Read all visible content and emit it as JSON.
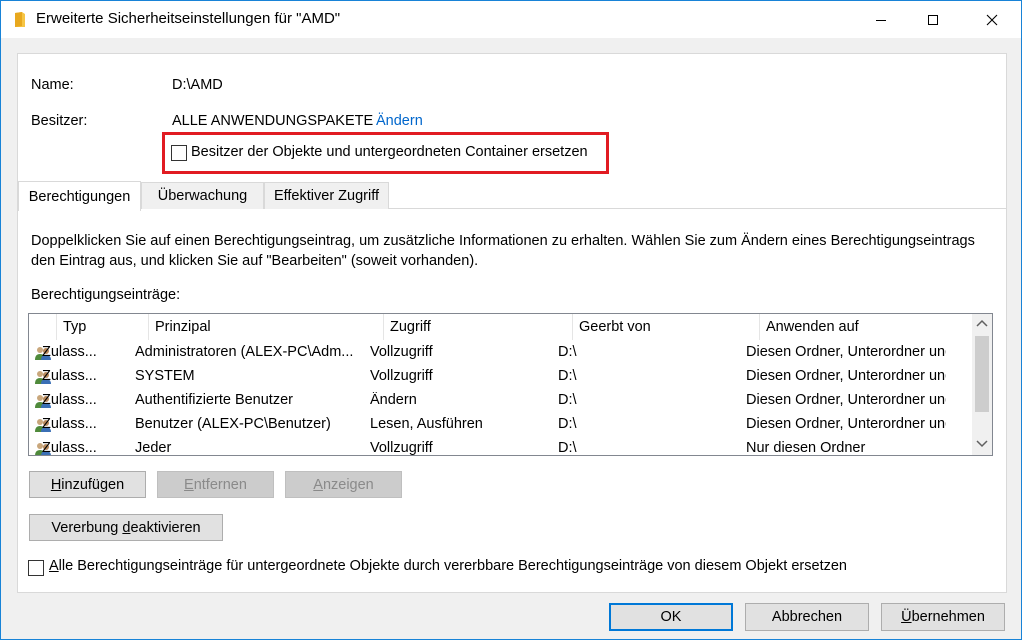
{
  "window": {
    "title": "Erweiterte Sicherheitseinstellungen für \"AMD\""
  },
  "info": {
    "name_label": "Name:",
    "name_value": "D:\\AMD",
    "owner_label": "Besitzer:",
    "owner_value": "ALLE ANWENDUNGSPAKETE",
    "owner_change_link": "Ändern",
    "replace_owner_checkbox": "Besitzer der Objekte und untergeordneten Container ersetzen"
  },
  "tabs": [
    {
      "label": "Berechtigungen"
    },
    {
      "label": "Überwachung"
    },
    {
      "label": "Effektiver Zugriff"
    }
  ],
  "description": {
    "line1": "Doppelklicken Sie auf einen Berechtigungseintrag, um zusätzliche Informationen zu erhalten. Wählen Sie zum Ändern eines Berechtigungseintrags",
    "line2": "den Eintrag aus, und klicken Sie auf \"Bearbeiten\" (soweit vorhanden)."
  },
  "entries": {
    "label": "Berechtigungseinträge:",
    "columns": [
      "Typ",
      "Prinzipal",
      "Zugriff",
      "Geerbt von",
      "Anwenden auf"
    ],
    "rows": [
      {
        "type": "Zulass...",
        "principal": "Administratoren (ALEX-PC\\Adm...",
        "access": "Vollzugriff",
        "inherited": "D:\\",
        "applies": "Diesen Ordner, Unterordner und ..."
      },
      {
        "type": "Zulass...",
        "principal": "SYSTEM",
        "access": "Vollzugriff",
        "inherited": "D:\\",
        "applies": "Diesen Ordner, Unterordner und ..."
      },
      {
        "type": "Zulass...",
        "principal": "Authentifizierte Benutzer",
        "access": "Ändern",
        "inherited": "D:\\",
        "applies": "Diesen Ordner, Unterordner und ..."
      },
      {
        "type": "Zulass...",
        "principal": "Benutzer (ALEX-PC\\Benutzer)",
        "access": "Lesen, Ausführen",
        "inherited": "D:\\",
        "applies": "Diesen Ordner, Unterordner und ..."
      },
      {
        "type": "Zulass...",
        "principal": "Jeder",
        "access": "Vollzugriff",
        "inherited": "D:\\",
        "applies": "Nur diesen Ordner"
      }
    ]
  },
  "buttons": {
    "add": {
      "pre": "",
      "acc": "H",
      "post": "inzufügen"
    },
    "remove": {
      "pre": "",
      "acc": "E",
      "post": "ntfernen"
    },
    "view": {
      "pre": "",
      "acc": "A",
      "post": "nzeigen"
    },
    "disable_inheritance": {
      "pre": "Vererbung ",
      "acc": "d",
      "post": "eaktivieren"
    },
    "ok": "OK",
    "cancel": "Abbrechen",
    "apply": {
      "pre": "",
      "acc": "Ü",
      "post": "bernehmen"
    }
  },
  "replace_child_checkbox": {
    "pre": "",
    "acc": "A",
    "post": "lle Berechtigungseinträge für untergeordnete Objekte durch vererbbare Berechtigungseinträge von diesem Objekt ersetzen"
  },
  "colors": {
    "accent": "#0078d7",
    "link": "#0066cc",
    "highlight_box": "#e11b22"
  },
  "icons": [
    "folder-icon",
    "minimize-icon",
    "maximize-icon",
    "close-icon",
    "users-icon",
    "scroll-up-icon",
    "scroll-down-icon"
  ]
}
